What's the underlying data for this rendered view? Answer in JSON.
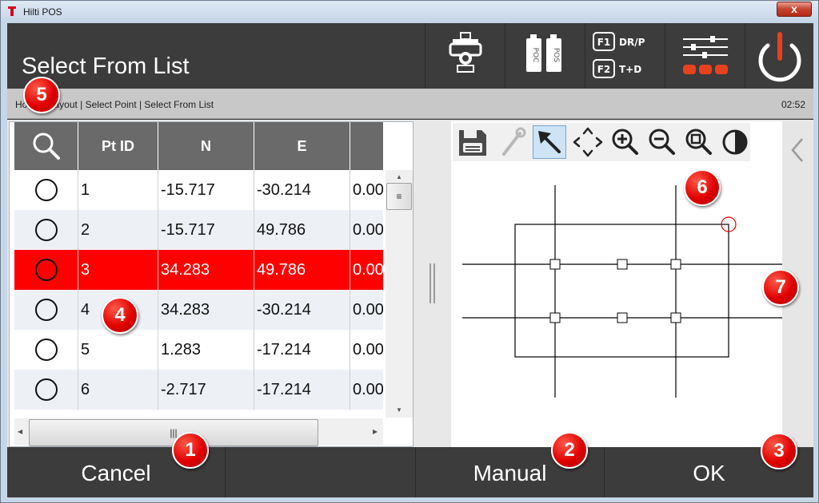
{
  "window": {
    "title": "Hilti POS",
    "close_label": "x"
  },
  "header": {
    "title": "Select From List",
    "f1_key": "F1",
    "f1_label": "DR/P",
    "f2_key": "F2",
    "f2_label": "T+D",
    "battery_left": "POC",
    "battery_right": "POS"
  },
  "breadcrumb": {
    "text": "Home | Layout | Select Point | Select From List",
    "time": "02:52"
  },
  "table": {
    "columns": [
      "Pt ID",
      "N",
      "E"
    ],
    "rows": [
      {
        "id": "1",
        "n": "-15.717",
        "e": "-30.214",
        "h": "0.00"
      },
      {
        "id": "2",
        "n": "-15.717",
        "e": "49.786",
        "h": "0.00"
      },
      {
        "id": "3",
        "n": "34.283",
        "e": "49.786",
        "h": "0.00"
      },
      {
        "id": "4",
        "n": "34.283",
        "e": "-30.214",
        "h": "0.00"
      },
      {
        "id": "5",
        "n": "1.283",
        "e": "-17.214",
        "h": "0.00"
      },
      {
        "id": "6",
        "n": "-2.717",
        "e": "-17.214",
        "h": "0.00"
      }
    ]
  },
  "bottom": {
    "cancel": "Cancel",
    "manual": "Manual",
    "ok": "OK"
  },
  "callouts": [
    "1",
    "2",
    "3",
    "4",
    "5",
    "6",
    "7"
  ]
}
